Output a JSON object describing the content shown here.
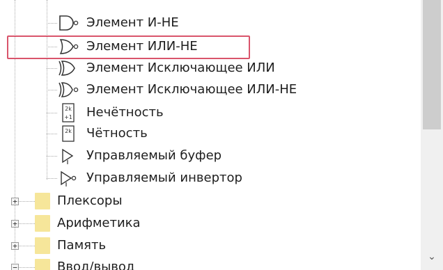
{
  "tree": {
    "gates": [
      {
        "label": "Элемент И-НЕ",
        "icon": "nand-gate-icon"
      },
      {
        "label": "Элемент ИЛИ-НЕ",
        "icon": "nor-gate-icon",
        "selected": true
      },
      {
        "label": "Элемент Исключающее ИЛИ",
        "icon": "xor-gate-icon"
      },
      {
        "label": "Элемент Исключающее ИЛИ-НЕ",
        "icon": "xnor-gate-icon"
      },
      {
        "label": "Нечётность",
        "icon": "odd-parity-icon",
        "icon_text": [
          "2k",
          "+1"
        ]
      },
      {
        "label": "Чётность",
        "icon": "even-parity-icon",
        "icon_text": [
          "2k"
        ]
      },
      {
        "label": "Управляемый буфер",
        "icon": "controlled-buffer-icon"
      },
      {
        "label": "Управляемый инвертор",
        "icon": "controlled-inverter-icon"
      }
    ],
    "folders": [
      {
        "label": "Плексоры",
        "expander": "+"
      },
      {
        "label": "Арифметика",
        "expander": "+"
      },
      {
        "label": "Память",
        "expander": "+"
      },
      {
        "label": "Ввод/вывод",
        "expander": "−"
      }
    ]
  },
  "scrollbar": {
    "down_arrow": "⌄"
  },
  "colors": {
    "selection_outline": "#d9546b",
    "folder": "#f6e69a"
  }
}
